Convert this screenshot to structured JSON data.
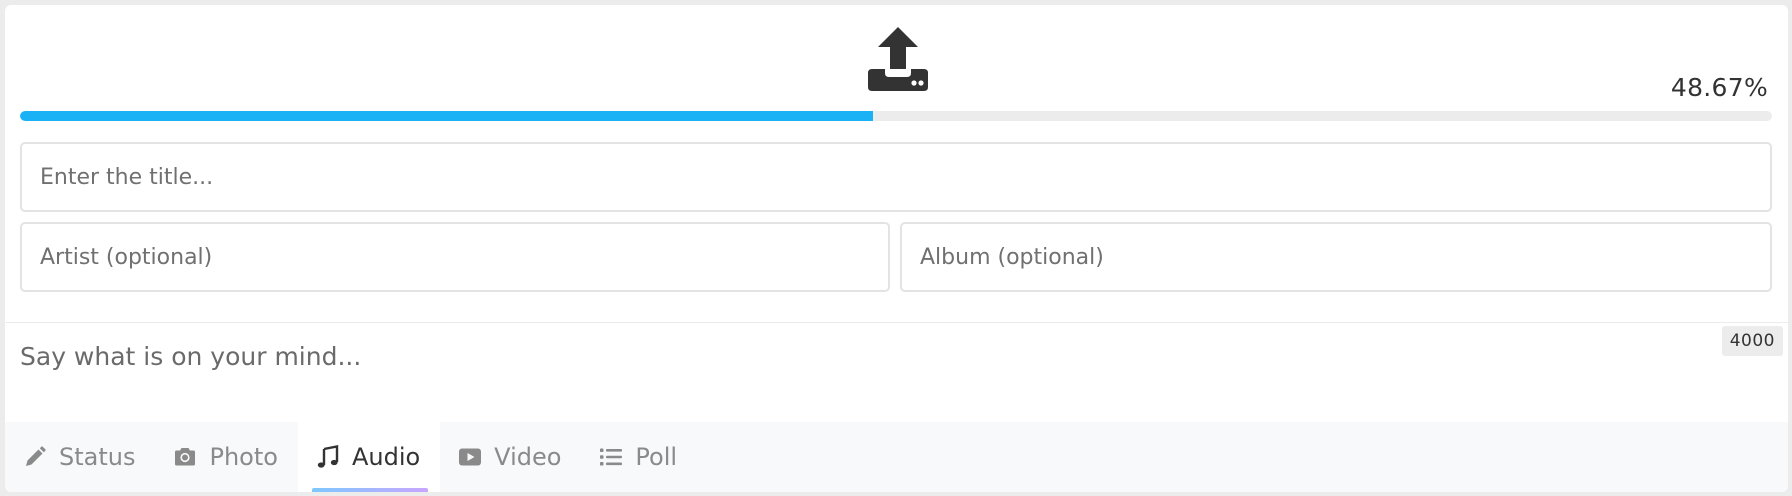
{
  "upload": {
    "icon": "upload-tray-icon",
    "progress_percent": 48.67,
    "progress_label": "48.67%",
    "progress_color": "#1bb2f5"
  },
  "fields": {
    "title_placeholder": "Enter the title...",
    "artist_placeholder": "Artist (optional)",
    "album_placeholder": "Album (optional)"
  },
  "composer": {
    "placeholder": "Say what is on your mind...",
    "char_limit": "4000"
  },
  "tabs": [
    {
      "label": "Status",
      "icon": "pencil-icon",
      "active": false
    },
    {
      "label": "Photo",
      "icon": "camera-icon",
      "active": false
    },
    {
      "label": "Audio",
      "icon": "music-note-icon",
      "active": true
    },
    {
      "label": "Video",
      "icon": "video-play-icon",
      "active": false
    },
    {
      "label": "Poll",
      "icon": "list-icon",
      "active": false
    }
  ]
}
